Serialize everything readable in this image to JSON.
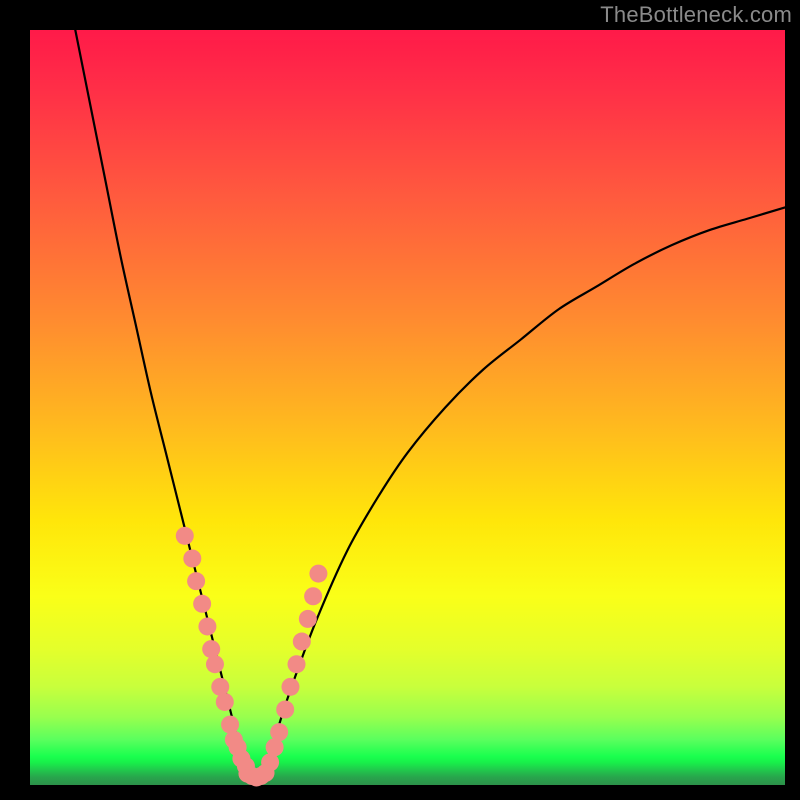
{
  "watermark": "TheBottleneck.com",
  "chart_data": {
    "type": "line",
    "title": "",
    "xlabel": "",
    "ylabel": "",
    "xlim": [
      0,
      100
    ],
    "ylim": [
      0,
      100
    ],
    "grid": false,
    "legend": false,
    "background_gradient": {
      "direction": "vertical",
      "stops": [
        {
          "pos": 0,
          "color": "#ff1a49"
        },
        {
          "pos": 22,
          "color": "#ff5a3e"
        },
        {
          "pos": 52,
          "color": "#ffb81f"
        },
        {
          "pos": 75,
          "color": "#faff18"
        },
        {
          "pos": 91,
          "color": "#98ff4e"
        },
        {
          "pos": 96,
          "color": "#1aff4e"
        },
        {
          "pos": 100,
          "color": "#2c9049"
        }
      ]
    },
    "series": [
      {
        "name": "bottleneck-curve",
        "color": "#000000",
        "style": "line",
        "x": [
          6,
          8,
          10,
          12,
          14,
          16,
          18,
          20,
          22,
          24,
          25,
          26,
          27,
          28,
          29,
          30,
          31,
          32,
          33,
          35,
          38,
          42,
          46,
          50,
          55,
          60,
          65,
          70,
          75,
          80,
          85,
          90,
          95,
          100
        ],
        "y": [
          100,
          90,
          80,
          70,
          61,
          52,
          44,
          36,
          28,
          20,
          16,
          12,
          8,
          4,
          2,
          1,
          2,
          4,
          8,
          14,
          22,
          31,
          38,
          44,
          50,
          55,
          59,
          63,
          66,
          69,
          71.5,
          73.5,
          75,
          76.5
        ]
      },
      {
        "name": "highlight-dots-left",
        "color": "#f28a86",
        "style": "scatter",
        "x": [
          20.5,
          21.5,
          22.0,
          22.8,
          23.5,
          24.0,
          24.5,
          25.2,
          25.8,
          26.5,
          27.0,
          27.5,
          28.0,
          28.6
        ],
        "y": [
          33,
          30,
          27,
          24,
          21,
          18,
          16,
          13,
          11,
          8,
          6,
          5,
          3.5,
          2.5
        ]
      },
      {
        "name": "highlight-dots-bottom",
        "color": "#f28a86",
        "style": "scatter",
        "x": [
          28.8,
          29.4,
          30.0,
          30.6,
          31.2
        ],
        "y": [
          1.5,
          1.2,
          1.0,
          1.2,
          1.6
        ]
      },
      {
        "name": "highlight-dots-right",
        "color": "#f28a86",
        "style": "scatter",
        "x": [
          31.8,
          32.4,
          33.0,
          33.8,
          34.5,
          35.3,
          36.0,
          36.8,
          37.5,
          38.2
        ],
        "y": [
          3,
          5,
          7,
          10,
          13,
          16,
          19,
          22,
          25,
          28
        ]
      }
    ]
  }
}
